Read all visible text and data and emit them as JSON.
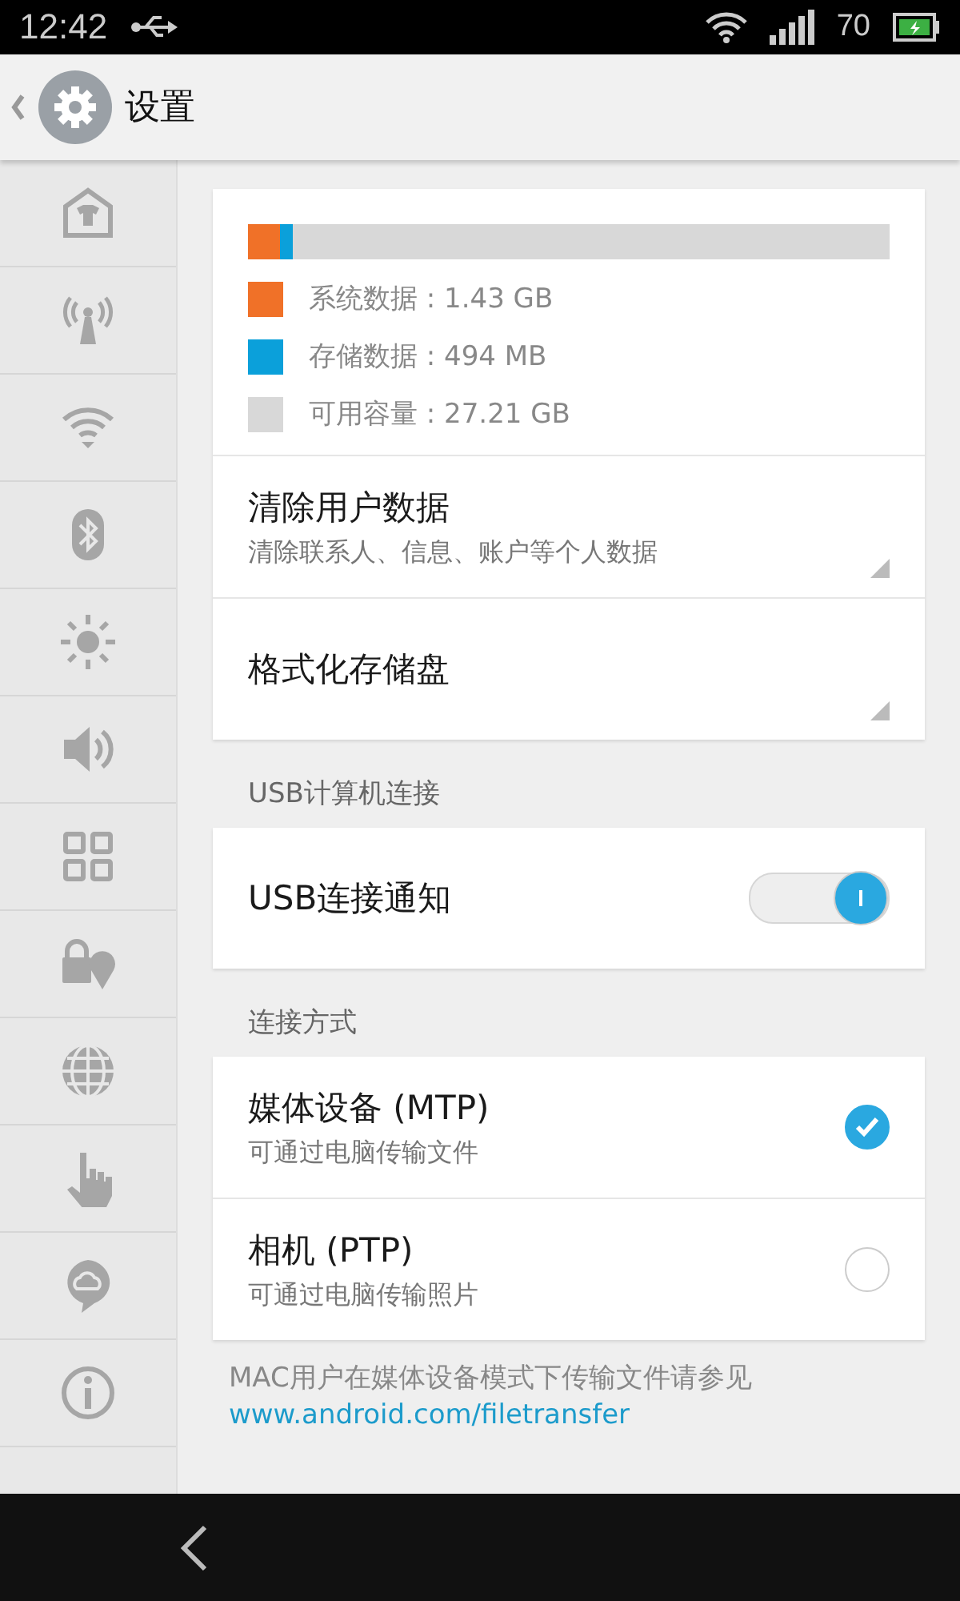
{
  "status_bar": {
    "time": "12:42",
    "battery": "70"
  },
  "header": {
    "title": "设置"
  },
  "sidebar": {
    "items": [
      {
        "kind": "theme"
      },
      {
        "kind": "antenna"
      },
      {
        "kind": "wifi"
      },
      {
        "kind": "bluetooth"
      },
      {
        "kind": "brightness"
      },
      {
        "kind": "sound"
      },
      {
        "kind": "apps"
      },
      {
        "kind": "lock"
      },
      {
        "kind": "globe"
      },
      {
        "kind": "hand"
      },
      {
        "kind": "cloud"
      },
      {
        "kind": "info"
      }
    ]
  },
  "storage": {
    "bar": [
      {
        "color": "#f07128",
        "level": 0.05
      },
      {
        "color": "#0ba0da",
        "level": 0.02
      }
    ],
    "legend": [
      {
        "color": "#f07128",
        "label": "系统数据 : 1.43 GB"
      },
      {
        "color": "#0ba0da",
        "label": "存储数据 : 494 MB"
      },
      {
        "color": "#d8d8d8",
        "label": "可用容量 : 27.21 GB"
      }
    ],
    "actions": [
      {
        "title": "清除用户数据",
        "subtitle": "清除联系人、信息、账户等个人数据"
      },
      {
        "title": "格式化存储盘"
      }
    ]
  },
  "usb_section": {
    "header": "USB计算机连接",
    "toggle": {
      "label": "USB连接通知",
      "on": true
    }
  },
  "mode_section": {
    "header": "连接方式",
    "options": [
      {
        "title": "媒体设备 (MTP)",
        "subtitle": "可通过电脑传输文件",
        "selected": true
      },
      {
        "title": "相机 (PTP)",
        "subtitle": "可通过电脑传输照片",
        "selected": false
      }
    ]
  },
  "footer": {
    "text": "MAC用户在媒体设备模式下传输文件请参见",
    "link": "www.android.com/filetransfer"
  }
}
